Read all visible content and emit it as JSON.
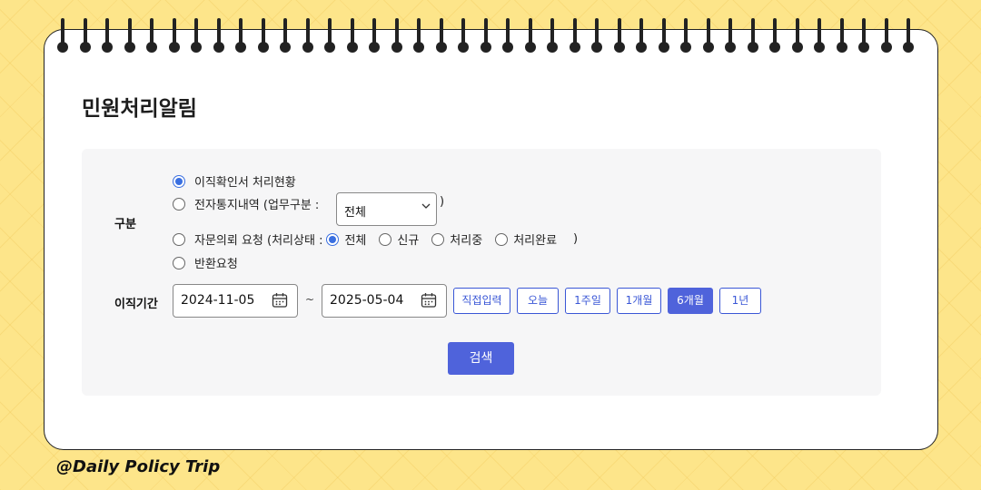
{
  "page_title": "민원처리알림",
  "filters": {
    "category_label": "구분",
    "options": [
      {
        "label": "이직확인서 처리현황",
        "selected": true
      },
      {
        "label": "전자통지내역 (업무구분 :",
        "selected": false
      },
      {
        "label": "자문의뢰 요청 (처리상태 :",
        "selected": false
      },
      {
        "label": "반환요청",
        "selected": false
      }
    ],
    "work_type_select": {
      "value": "전체",
      "close_paren": ")"
    },
    "status_options": [
      {
        "label": "전체",
        "selected": true
      },
      {
        "label": "신규",
        "selected": false
      },
      {
        "label": "처리중",
        "selected": false
      },
      {
        "label": "처리완료",
        "selected": false
      }
    ],
    "status_close_paren": ")"
  },
  "period": {
    "label": "이직기간",
    "start_date": "2024-11-05",
    "separator": "~",
    "end_date": "2025-05-04",
    "quick_buttons": [
      {
        "label": "직접입력",
        "active": false
      },
      {
        "label": "오늘",
        "active": false
      },
      {
        "label": "1주일",
        "active": false
      },
      {
        "label": "1개월",
        "active": false
      },
      {
        "label": "6개월",
        "active": true
      },
      {
        "label": "1년",
        "active": false
      }
    ]
  },
  "search_button": "검색",
  "watermark": "@Daily Policy Trip",
  "colors": {
    "accent": "#4f63db",
    "background": "#fde58a",
    "panel": "#f6f6f7"
  }
}
